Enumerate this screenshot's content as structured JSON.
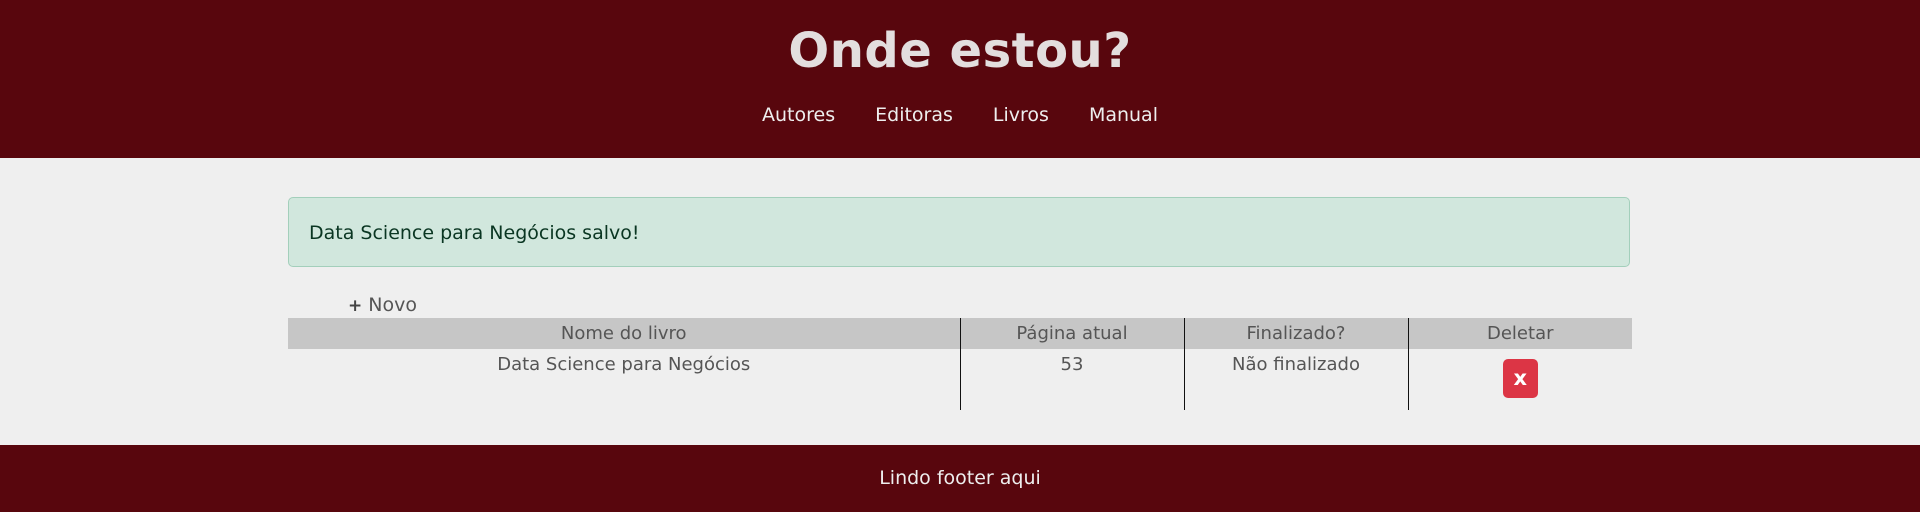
{
  "header": {
    "title": "Onde estou?",
    "nav": [
      {
        "label": "Autores"
      },
      {
        "label": "Editoras"
      },
      {
        "label": "Livros"
      },
      {
        "label": "Manual"
      }
    ]
  },
  "alert": {
    "message": "Data Science para Negócios salvo!"
  },
  "actions": {
    "new_icon": "+",
    "new_label": "Novo"
  },
  "table": {
    "columns": [
      "Nome do livro",
      "Página atual",
      "Finalizado?",
      "Deletar"
    ],
    "rows": [
      {
        "name": "Data Science para Negócios",
        "page": "53",
        "status": "Não finalizado",
        "delete_label": "x"
      }
    ]
  },
  "footer": {
    "text": "Lindo footer aqui"
  },
  "colors": {
    "header_bg": "#58060d",
    "page_bg": "#efefef",
    "alert_bg": "#d1e7dd",
    "table_header_bg": "#c6c6c6",
    "delete_button": "#dc3545"
  }
}
